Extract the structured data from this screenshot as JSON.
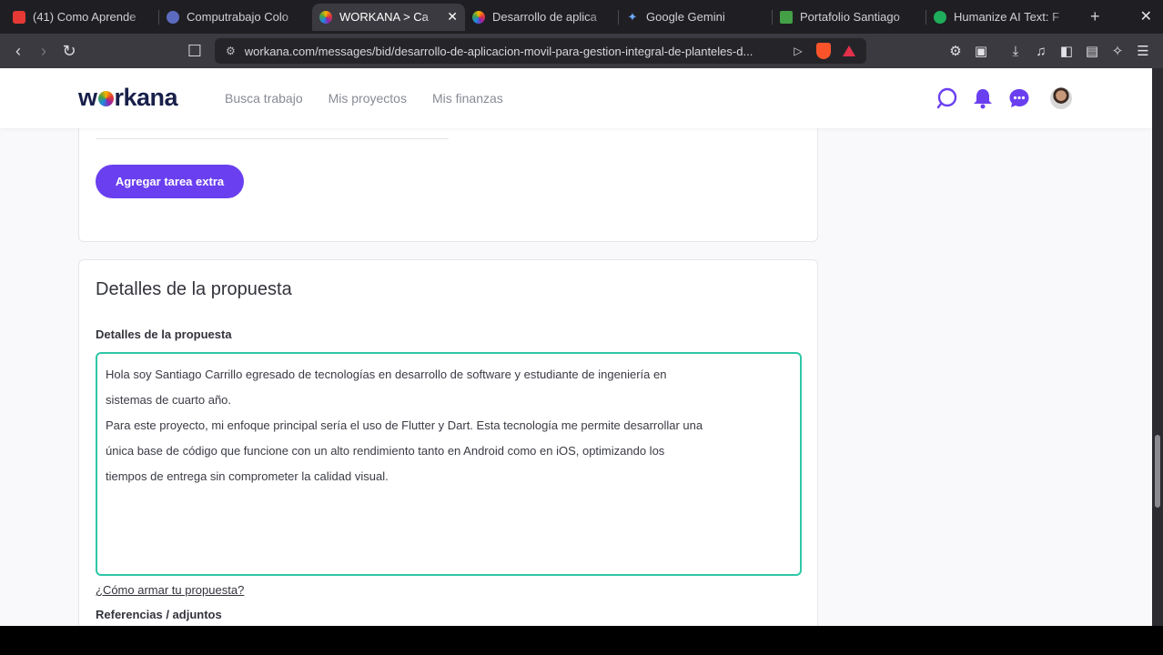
{
  "browser": {
    "tabs": [
      {
        "title": "(41) Como Aprende",
        "color": "#e53935",
        "icon": "youtube-icon"
      },
      {
        "title": "Computrabajo Colo",
        "color": "#5c6bc0",
        "icon": "computrabajo-icon"
      },
      {
        "title": "WORKANA > Ca",
        "color": "#ab47bc",
        "icon": "workana-icon",
        "active": true
      },
      {
        "title": "Desarrollo de aplica",
        "color": "#ab47bc",
        "icon": "workana-icon"
      },
      {
        "title": "Google Gemini",
        "color": "#4285f4",
        "icon": "gemini-icon"
      },
      {
        "title": "Portafolio Santiago",
        "color": "#43a047",
        "icon": "portfolio-icon"
      },
      {
        "title": "Humanize AI Text: F",
        "color": "#1fae5b",
        "icon": "grammarly-icon"
      }
    ],
    "url": "workana.com/messages/bid/desarrollo-de-aplicacion-movil-para-gestion-integral-de-planteles-d..."
  },
  "header": {
    "logo": "workana",
    "nav": [
      "Busca trabajo",
      "Mis proyectos",
      "Mis finanzas"
    ],
    "accent": "#6a3ff0"
  },
  "card1": {
    "button": "Agregar tarea extra"
  },
  "proposal": {
    "title": "Detalles de la propuesta",
    "field_label": "Detalles de la propuesta",
    "text_lines": [
      "Hola soy Santiago Carrillo egresado de tecnologías en desarrollo de software y estudiante de ingeniería en",
      "sistemas de cuarto año.",
      "Para este proyecto, mi enfoque principal sería el uso de Flutter y Dart. Esta tecnología me permite desarrollar una",
      "única base de código que funcione con un alto rendimiento tanto en Android como en iOS, optimizando los",
      "tiempos de entrega sin comprometer la calidad visual."
    ],
    "help_link": "¿Cómo armar tu propuesta?",
    "references_label": "Referencias / adjuntos",
    "border_color": "#2fc7a6"
  }
}
